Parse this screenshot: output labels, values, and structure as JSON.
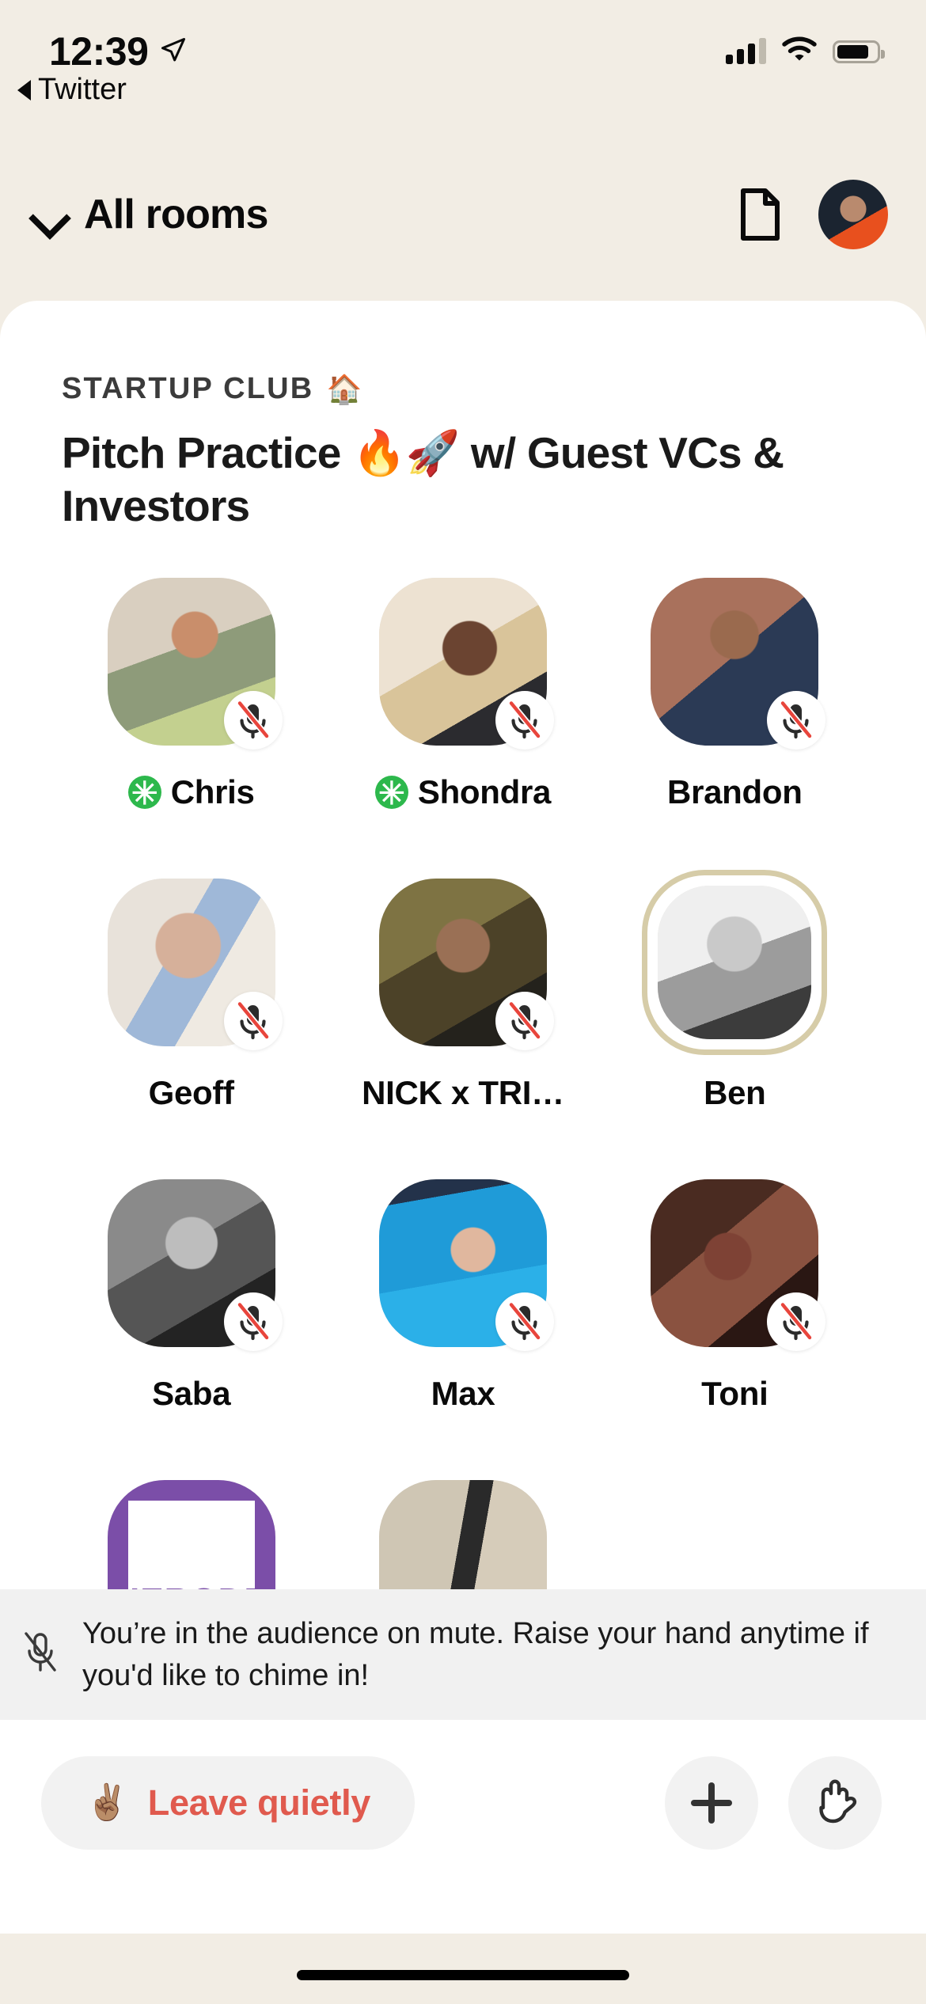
{
  "status_bar": {
    "time": "12:39",
    "location_icon": "location-arrow-icon",
    "signal_icon": "cellular-signal-icon",
    "wifi_icon": "wifi-icon",
    "battery_icon": "battery-icon",
    "battery_level_pct": 82
  },
  "back_to_app": {
    "label": "Twitter",
    "icon": "back-triangle-icon"
  },
  "nav": {
    "rooms_label": "All rooms",
    "chevron_icon": "chevron-down-icon",
    "invite_doc_icon": "document-icon",
    "profile_avatar_icon": "profile-avatar"
  },
  "room": {
    "club_name": "STARTUP CLUB",
    "club_emoji": "🏠",
    "title": "Pitch Practice 🔥🚀 w/ Guest VCs & Investors"
  },
  "people": [
    {
      "name": "Chris",
      "moderator": true,
      "muted": true,
      "speaking": false,
      "photo_class": "p-chris"
    },
    {
      "name": "Shondra",
      "moderator": true,
      "muted": true,
      "speaking": false,
      "photo_class": "p-shondra"
    },
    {
      "name": "Brandon",
      "moderator": false,
      "muted": true,
      "speaking": false,
      "photo_class": "p-brandon"
    },
    {
      "name": "Geoff",
      "moderator": false,
      "muted": true,
      "speaking": false,
      "photo_class": "p-geoff"
    },
    {
      "name": "NICK x TRI…",
      "moderator": false,
      "muted": true,
      "speaking": false,
      "photo_class": "p-nick"
    },
    {
      "name": "Ben",
      "moderator": false,
      "muted": false,
      "speaking": true,
      "photo_class": "p-ben"
    },
    {
      "name": "Saba",
      "moderator": false,
      "muted": true,
      "speaking": false,
      "photo_class": "p-saba"
    },
    {
      "name": "Max",
      "moderator": false,
      "muted": true,
      "speaking": false,
      "photo_class": "p-max"
    },
    {
      "name": "Toni",
      "moderator": false,
      "muted": true,
      "speaking": false,
      "photo_class": "p-toni"
    },
    {
      "name": "",
      "moderator": false,
      "muted": false,
      "speaking": false,
      "photo_class": "p-herode"
    },
    {
      "name": "",
      "moderator": false,
      "muted": false,
      "speaking": false,
      "photo_class": "p-selfie"
    }
  ],
  "partial_row_logo_text": "HERODE",
  "mute_banner": {
    "icon": "mic-off-icon",
    "text": "You’re in the audience on mute. Raise your hand anytime if you'd like to chime in!"
  },
  "bottom_bar": {
    "leave_emoji": "✌🏽",
    "leave_label": "Leave quietly",
    "add_people_icon": "plus-icon",
    "raise_hand_icon": "raised-hand-icon"
  },
  "colors": {
    "page_background": "#F2EDE4",
    "card_background": "#FFFFFF",
    "banner_background": "#F1F1F1",
    "moderator_green": "#2DB84C",
    "leave_red": "#E05A4E",
    "speaking_ring": "#D6CCA8",
    "mic_slash_red": "#E8453C",
    "pill_gray": "#F2F2F2"
  },
  "home_indicator": "home-indicator"
}
